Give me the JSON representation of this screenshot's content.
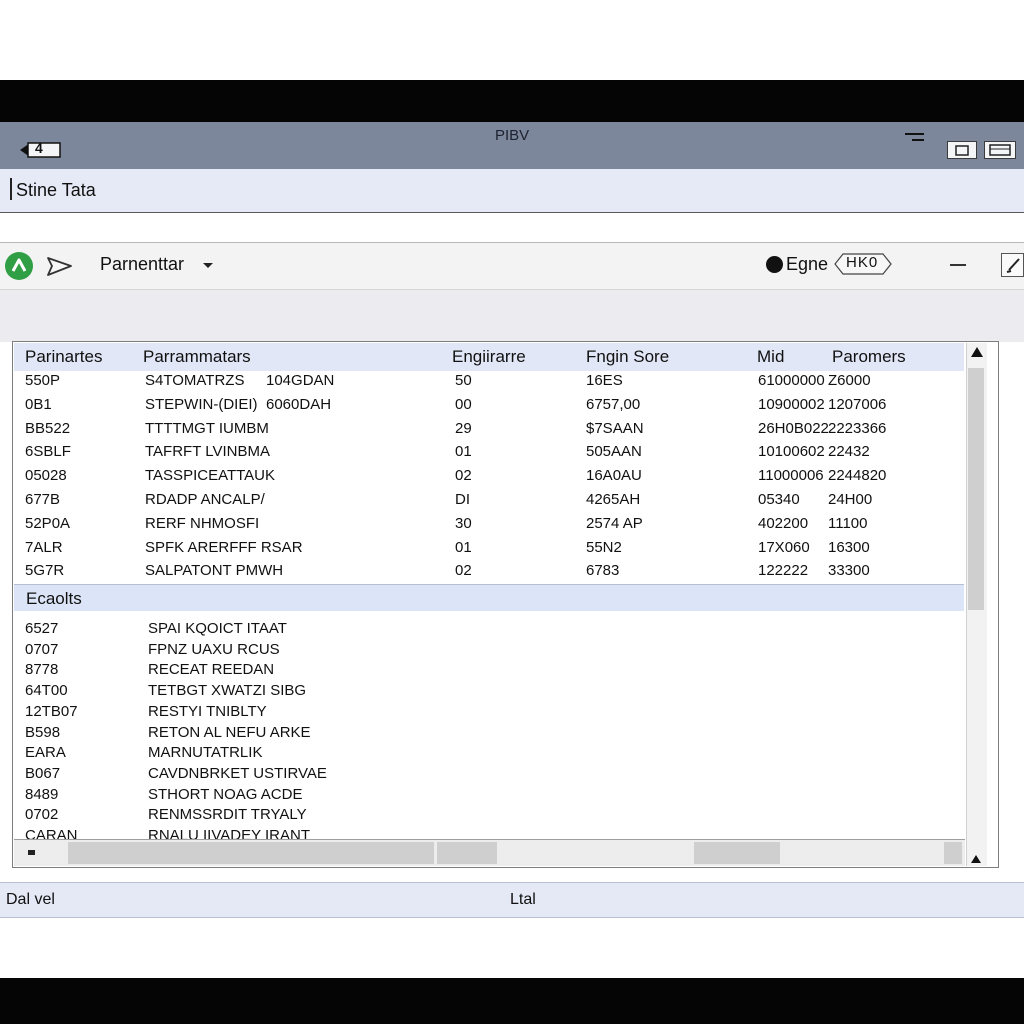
{
  "window": {
    "title": "PIBV",
    "back_label": "4",
    "app_subtitle": "Stine Tata"
  },
  "toolbar": {
    "parameter_label": "Parnenttar",
    "engine_label": "Egne",
    "engine_chip": "HK0"
  },
  "table": {
    "columns": [
      "Parinartes",
      "Parrammatars",
      "Engiirarre",
      "Fngin Sore",
      "Mid",
      "Paromers"
    ],
    "rows": [
      [
        "550P",
        "S4TOMATRZS",
        "104GDAN",
        "50",
        "16ES",
        "61000000",
        "Z6000"
      ],
      [
        "0B1",
        "STEPWIN-(DIEI)",
        "6060DAH",
        "00",
        "6757,00",
        "10900002",
        "1207006"
      ],
      [
        "BB522",
        "TTTTMGT IUMBM",
        "",
        "29",
        "$7SAAN",
        "26H0B022",
        "2223366"
      ],
      [
        "6SBLF",
        "TAFRFT LVINBMA",
        "",
        "01",
        "505AAN",
        "10100602",
        "22432"
      ],
      [
        "05028",
        "TASSPICEATTAUK",
        "",
        "02",
        "16A0AU",
        "11000006",
        "2244820"
      ],
      [
        "677B",
        "RDADP ANCALP/",
        "",
        "DI",
        "4265AH",
        "05340",
        "24H00"
      ],
      [
        "52P0A",
        "RERF NHMOSFI",
        "",
        "30",
        "2574 AP",
        "402200",
        "11100"
      ],
      [
        "7ALR",
        "SPFK ARERFFF RSAR",
        "",
        "01",
        "55N2",
        "17X060",
        "16300"
      ],
      [
        "5G7R",
        "SALPATONT PMWH",
        "",
        "02",
        "6783",
        "122222",
        "33300"
      ]
    ],
    "events_header": "Ecaolts",
    "events": [
      [
        "6527",
        "SPAI KQOICT ITAAT"
      ],
      [
        "0707",
        "FPNZ UAXU RCUS"
      ],
      [
        "8778",
        "RECEAT REEDAN"
      ],
      [
        "64T00",
        "TETBGT XWATZI SIBG"
      ],
      [
        "12TB07",
        "RESTYI TNIBLTY"
      ],
      [
        "B598",
        "RETON AL NEFU ARKE"
      ],
      [
        "EARA",
        "MARNUTATRLIK"
      ],
      [
        "B067",
        "CAVDNBRKET USTIRVAE"
      ],
      [
        "8489",
        "STHORT NOAG ACDE"
      ],
      [
        "0702",
        "RENMSSRDIT TRYALY"
      ],
      [
        "CARAN",
        "RNALU IIVADEY IRANT"
      ]
    ]
  },
  "statusbar": {
    "left": "Dal vel",
    "center": "Ltal"
  },
  "colors": {
    "title_bar": "#7c879b",
    "header_row": "#e2e7f7",
    "status_bar": "#e5e9f6",
    "green_icon": "#2f9e45"
  }
}
